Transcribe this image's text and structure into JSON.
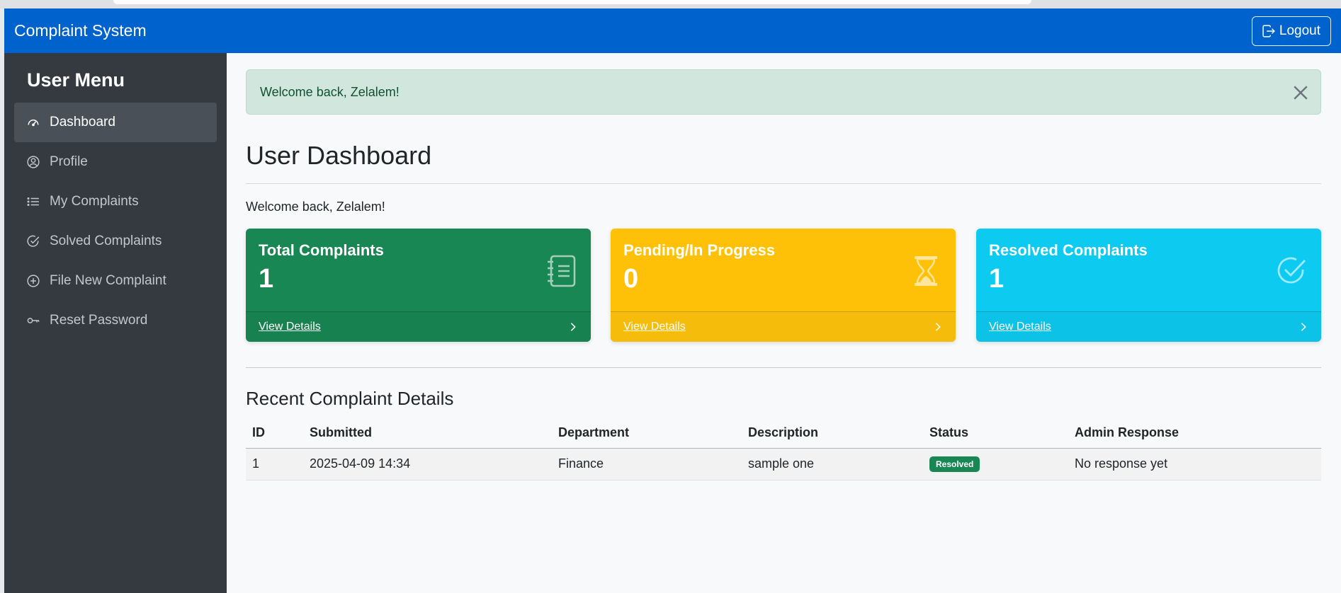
{
  "navbar": {
    "brand": "Complaint System",
    "logout_label": "Logout"
  },
  "sidebar": {
    "title": "User Menu",
    "items": [
      {
        "label": "Dashboard",
        "icon": "speedometer-icon",
        "active": true
      },
      {
        "label": "Profile",
        "icon": "person-circle-icon"
      },
      {
        "label": "My Complaints",
        "icon": "list-icon"
      },
      {
        "label": "Solved Complaints",
        "icon": "check-circle-icon"
      },
      {
        "label": "File New Complaint",
        "icon": "plus-circle-icon"
      },
      {
        "label": "Reset Password",
        "icon": "key-icon"
      }
    ]
  },
  "alert": {
    "message": "Welcome back, Zelalem!"
  },
  "page": {
    "title": "User Dashboard",
    "welcome": "Welcome back, Zelalem!"
  },
  "cards": [
    {
      "title": "Total Complaints",
      "value": "1",
      "link": "View Details",
      "color": "#198754",
      "icon": "journal-text-icon"
    },
    {
      "title": "Pending/In Progress",
      "value": "0",
      "link": "View Details",
      "color": "#ffc107",
      "icon": "hourglass-icon"
    },
    {
      "title": "Resolved Complaints",
      "value": "1",
      "link": "View Details",
      "color": "#0dcaf0",
      "icon": "check-circle-icon"
    }
  ],
  "recent": {
    "title": "Recent Complaint Details",
    "headers": [
      "ID",
      "Submitted",
      "Department",
      "Description",
      "Status",
      "Admin Response"
    ],
    "rows": [
      {
        "id": "1",
        "submitted": "2025-04-09 14:34",
        "department": "Finance",
        "description": "sample one",
        "status": "Resolved",
        "status_color": "#198754",
        "response": "No response yet"
      }
    ]
  }
}
